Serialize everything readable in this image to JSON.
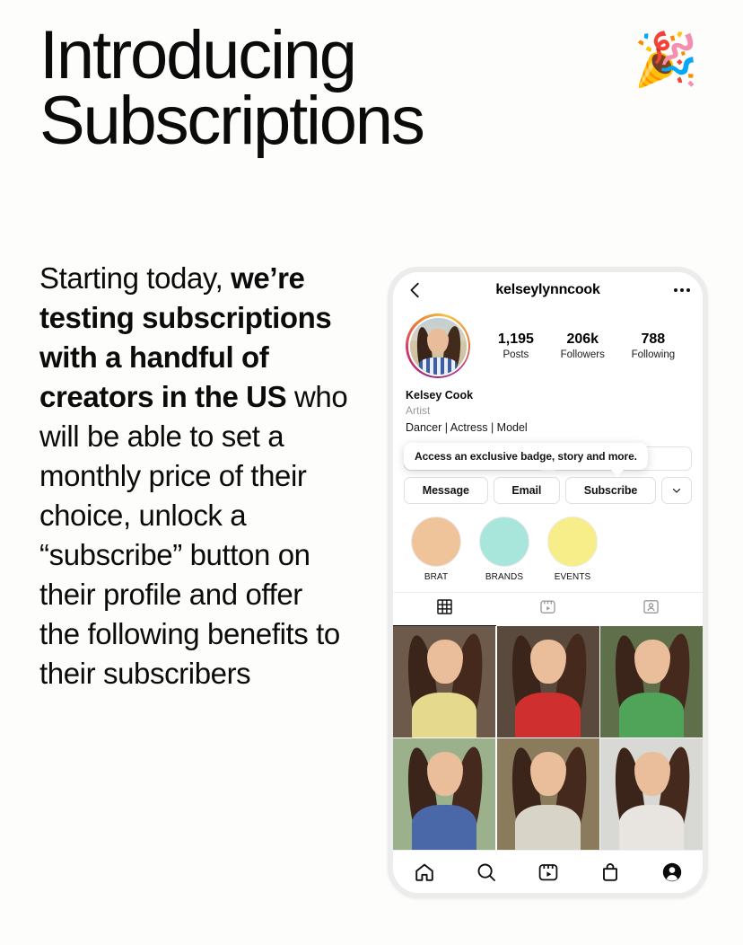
{
  "headline": {
    "line1": "Introducing",
    "line2": "Subscriptions"
  },
  "emoji": {
    "popper": "🎉",
    "name": "party-popper-emoji"
  },
  "body": {
    "part1": "Starting today, ",
    "bold": "we’re testing subscriptions with a handful of creators in the US",
    "part2": " who will be able to set a monthly price of their choice, unlock a “subscribe” button on their profile and offer the following benefits to their subscribers"
  },
  "phone": {
    "topbar": {
      "username": "kelseylynncook",
      "back_icon": "chevron-left-icon",
      "more_icon": "more-options-icon"
    },
    "profile": {
      "avatar_alt": "profile-avatar",
      "stats": [
        {
          "value": "1,195",
          "label": "Posts"
        },
        {
          "value": "206k",
          "label": "Followers"
        },
        {
          "value": "788",
          "label": "Following"
        }
      ]
    },
    "bio": {
      "name": "Kelsey Cook",
      "category": "Artist",
      "description": "Dancer | Actress | Model"
    },
    "tooltip": {
      "text": "Access an exclusive badge, story and more."
    },
    "buttons": [
      {
        "label": "Message",
        "name": "message-button"
      },
      {
        "label": "Email",
        "name": "email-button"
      },
      {
        "label": "Subscribe",
        "name": "subscribe-button"
      }
    ],
    "chevron_button": {
      "name": "more-actions-chevron-button",
      "icon": "chevron-down-icon"
    },
    "highlights": [
      {
        "label": "BRAT",
        "color": "#f0c49a"
      },
      {
        "label": "BRANDS",
        "color": "#a8e6db"
      },
      {
        "label": "EVENTS",
        "color": "#f7ee8a"
      }
    ],
    "tabs": [
      {
        "name": "tab-grid",
        "icon": "grid-icon",
        "active": true
      },
      {
        "name": "tab-reels",
        "icon": "reels-icon",
        "active": false
      },
      {
        "name": "tab-tagged",
        "icon": "tagged-icon",
        "active": false
      }
    ],
    "grid_posts": [
      {
        "name": "post-thumbnail-1",
        "bg": "#6d5a4a",
        "torso": "#e4d98c"
      },
      {
        "name": "post-thumbnail-2",
        "bg": "#5a4a3e",
        "torso": "#cf2f2f"
      },
      {
        "name": "post-thumbnail-3",
        "bg": "#5e6f4a",
        "torso": "#4fa45a"
      },
      {
        "name": "post-thumbnail-4",
        "bg": "#9bb18c",
        "torso": "#4a68a8"
      },
      {
        "name": "post-thumbnail-5",
        "bg": "#8a7b5c",
        "torso": "#d9d4c8"
      },
      {
        "name": "post-thumbnail-6",
        "bg": "#d8d8d4",
        "torso": "#e8e4df"
      }
    ],
    "bottom_nav": [
      {
        "name": "nav-home",
        "icon": "home-icon"
      },
      {
        "name": "nav-search",
        "icon": "search-icon"
      },
      {
        "name": "nav-reels",
        "icon": "reels-icon"
      },
      {
        "name": "nav-shop",
        "icon": "shop-bag-icon"
      },
      {
        "name": "nav-profile",
        "icon": "profile-avatar-icon"
      }
    ]
  },
  "colors": {
    "background": "#fdfdfb",
    "text": "#0b0b0b",
    "phone_frame": "#ececec",
    "muted": "#9a9a9a"
  }
}
